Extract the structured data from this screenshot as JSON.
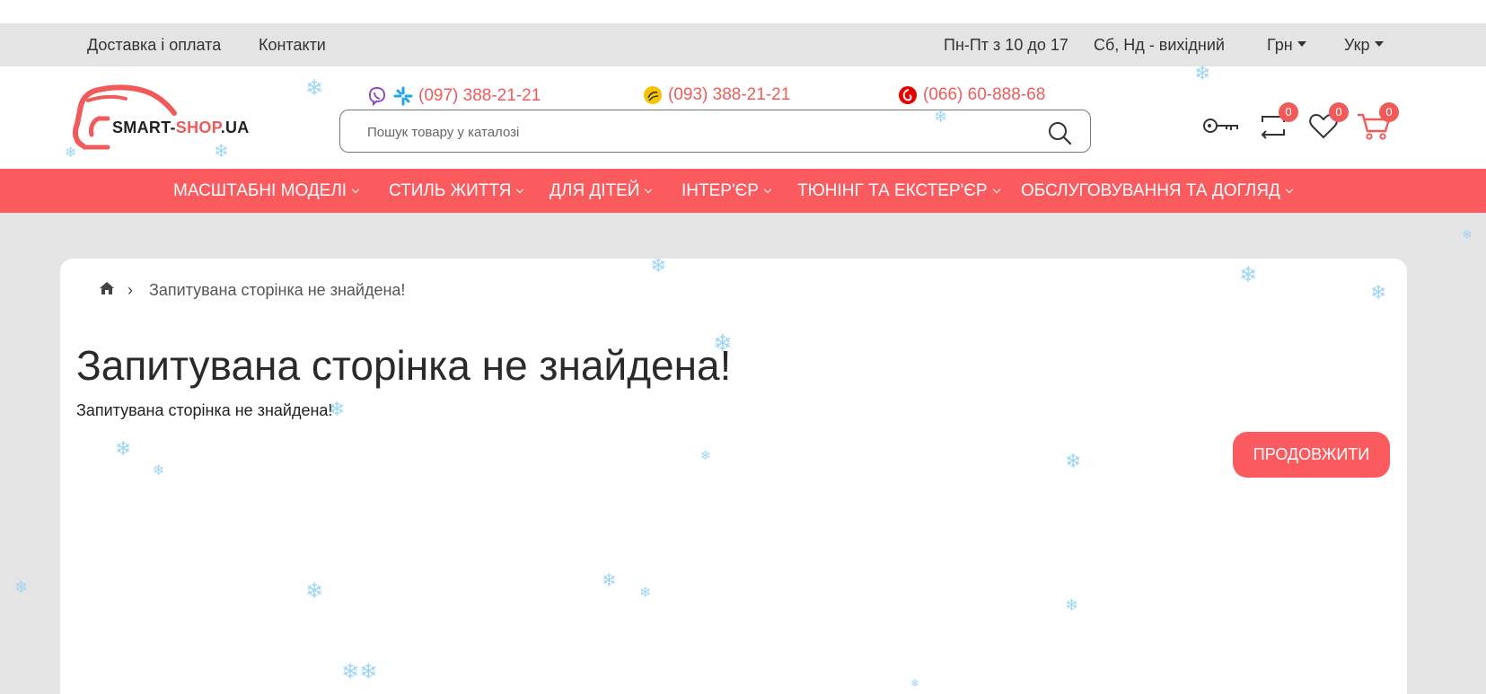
{
  "topbar": {
    "links": [
      "Доставка і оплата",
      "Контакти"
    ],
    "schedule_weekdays": "Пн-Пт з 10 до 17",
    "schedule_weekend": "Сб, Нд - вихідний",
    "currency": "Грн",
    "language": "Укр"
  },
  "header": {
    "logo": {
      "part1": "SMART-",
      "part2": "SHOP",
      "part3": ".UA"
    },
    "phones": [
      "(097) 388-21-21",
      "(093) 388-21-21",
      "(066) 60-888-68"
    ],
    "search_placeholder": "Пошук товару у каталозі",
    "compare_count": "0",
    "wishlist_count": "0",
    "cart_count": "0"
  },
  "nav": {
    "items": [
      "МАСШТАБНІ МОДЕЛІ",
      "СТИЛЬ ЖИТТЯ",
      "ДЛЯ ДІТЕЙ",
      "ІНТЕР'ЄР",
      "ТЮНІНГ ТА ЕКСТЕР'ЄР",
      "ОБСЛУГОВУВАННЯ ТА ДОГЛЯД"
    ]
  },
  "breadcrumb": {
    "current": "Запитувана сторінка не знайдена!"
  },
  "main": {
    "title": "Запитувана сторінка не знайдена!",
    "text": "Запитувана сторінка не знайдена!",
    "continue_label": "ПРОДОВЖИТИ"
  },
  "colors": {
    "accent": "#fb5b5e",
    "phone_text": "#f05a5a",
    "snowflake": "#9ed6f2"
  }
}
